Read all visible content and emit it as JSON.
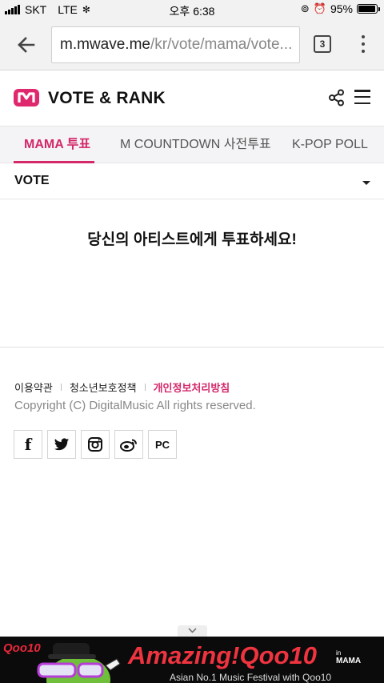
{
  "status_bar": {
    "carrier": "SKT",
    "network": "LTE",
    "time": "오후 6:38",
    "battery_percent": "95%",
    "battery_level": 0.95
  },
  "browser": {
    "url_host": "m.mwave.me",
    "url_path": "/kr/vote/mama/vote...",
    "tab_count": "3"
  },
  "header": {
    "title": "VOTE & RANK",
    "brand_color": "#e0286f"
  },
  "tabs": [
    {
      "label": "MAMA 투표",
      "active": true
    },
    {
      "label": "M COUNTDOWN 사전투표",
      "active": false
    },
    {
      "label": "K-POP POLL",
      "active": false
    }
  ],
  "vote_select": {
    "label": "VOTE"
  },
  "main": {
    "message": "당신의 아티스트에게 투표하세요!"
  },
  "footer": {
    "links": [
      {
        "label": "이용약관"
      },
      {
        "label": "청소년보호정책"
      },
      {
        "label": "개인정보처리방침"
      }
    ],
    "copyright": "Copyright (C) DigitalMusic All rights reserved.",
    "social": [
      {
        "icon": "facebook-icon",
        "label": "f"
      },
      {
        "icon": "twitter-icon"
      },
      {
        "icon": "instagram-icon"
      },
      {
        "icon": "weibo-icon"
      },
      {
        "icon": "pc-icon",
        "label": "PC"
      }
    ]
  },
  "ad": {
    "brand": "Qoo10",
    "title": "Amazing!Qoo10",
    "in_label": "in",
    "event": "MAMA",
    "subtitle": "Asian No.1 Music Festival with Qoo10"
  }
}
